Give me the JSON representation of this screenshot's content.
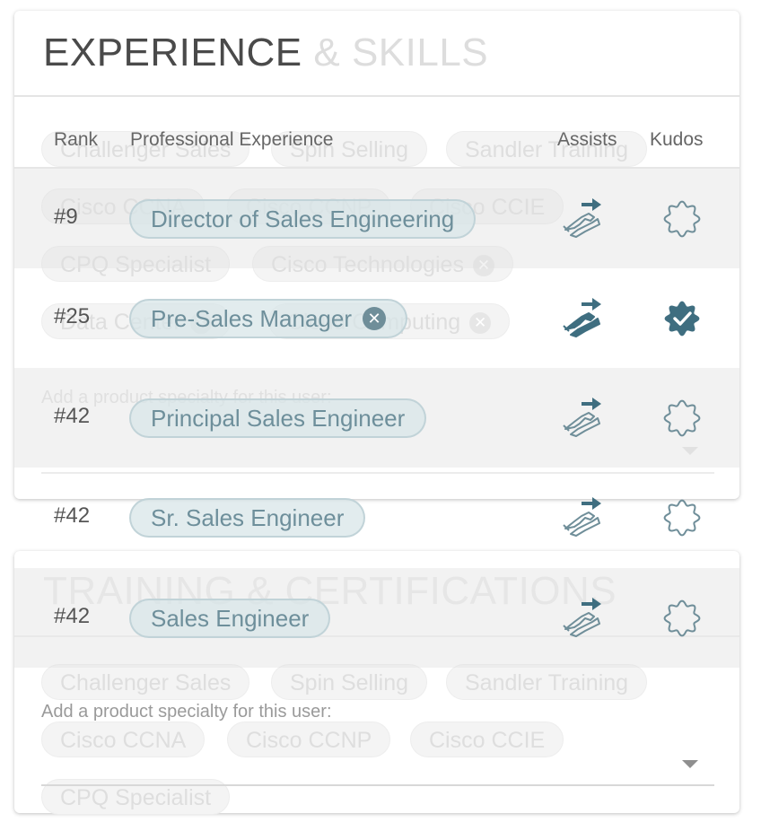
{
  "experience_card": {
    "title_strong": "EXPERIENCE",
    "title_light": "& SKILLS",
    "ghost_tags": [
      {
        "label": "Challenger Sales",
        "removable": false
      },
      {
        "label": "Spin Selling",
        "removable": false
      },
      {
        "label": "Sandler Training",
        "removable": false
      },
      {
        "label": "Cisco CCNA",
        "removable": false
      },
      {
        "label": "Cisco CCNP",
        "removable": false
      },
      {
        "label": "Cisco CCIE",
        "removable": false
      },
      {
        "label": "CPQ Specialist",
        "removable": false
      },
      {
        "label": "Cisco Technologies",
        "removable": true
      },
      {
        "label": "Data Center",
        "removable": true
      },
      {
        "label": "Cloud Computing",
        "removable": true
      }
    ],
    "add_label": "Add a product specialty for this user:"
  },
  "training_card": {
    "title": "TRAINING & CERTIFICATIONS",
    "ghost_tags": [
      {
        "label": "Challenger Sales"
      },
      {
        "label": "Spin Selling"
      },
      {
        "label": "Sandler Training"
      },
      {
        "label": "Cisco CCNA"
      },
      {
        "label": "Cisco CCNP"
      },
      {
        "label": "Cisco CCIE"
      },
      {
        "label": "CPQ Specialist"
      }
    ],
    "add_label": "Add a product specialty for this user:"
  },
  "table": {
    "headers": {
      "rank": "Rank",
      "experience": "Professional Experience",
      "assists": "Assists",
      "kudos": "Kudos"
    },
    "rows": [
      {
        "rank": "#9",
        "title": "Director of Sales Engineering",
        "removable": false,
        "assist_active": false,
        "kudo_active": false
      },
      {
        "rank": "#25",
        "title": "Pre-Sales Manager",
        "removable": true,
        "assist_active": true,
        "kudo_active": true
      },
      {
        "rank": "#42",
        "title": "Principal Sales Engineer",
        "removable": false,
        "assist_active": false,
        "kudo_active": false
      },
      {
        "rank": "#42",
        "title": "Sr. Sales Engineer",
        "removable": false,
        "assist_active": false,
        "kudo_active": false
      },
      {
        "rank": "#42",
        "title": "Sales Engineer",
        "removable": false,
        "assist_active": false,
        "kudo_active": false
      }
    ]
  },
  "colors": {
    "accent": "#3f6e80",
    "pill_text": "#6e8f9b",
    "icon_outline": "#6f8e99"
  },
  "icons": {
    "assist": "handshake-arrow-icon",
    "kudo": "badge-check-icon",
    "remove": "close-circle-icon",
    "dropdown": "caret-down-icon"
  }
}
